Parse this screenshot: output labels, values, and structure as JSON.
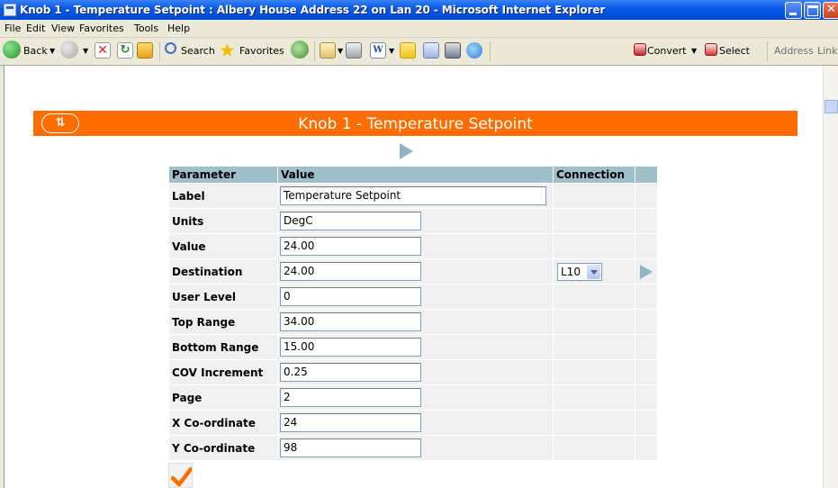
{
  "window": {
    "title": "Knob 1 - Temperature Setpoint : Albery House Address 22 on Lan 20 - Microsoft Internet Explorer"
  },
  "menu": [
    "File",
    "Edit",
    "View",
    "Favorites",
    "Tools",
    "Help"
  ],
  "toolbar": {
    "back": "Back",
    "search": "Search",
    "favorites": "Favorites",
    "convert": "Convert",
    "select": "Select",
    "address": "Address",
    "links": "Links"
  },
  "page": {
    "title": "Knob 1 - Temperature Setpoint",
    "columns": {
      "parameter": "Parameter",
      "value": "Value",
      "connection": "Connection"
    },
    "rows": [
      {
        "label": "Label",
        "value": "Temperature Setpoint"
      },
      {
        "label": "Units",
        "value": "DegC"
      },
      {
        "label": "Value",
        "value": "24.00"
      },
      {
        "label": "Destination",
        "value": "24.00",
        "connection": "L10"
      },
      {
        "label": "User Level",
        "value": "0"
      },
      {
        "label": "Top Range",
        "value": "34.00"
      },
      {
        "label": "Bottom Range",
        "value": "15.00"
      },
      {
        "label": "COV Increment",
        "value": "0.25"
      },
      {
        "label": "Page",
        "value": "2"
      },
      {
        "label": "X Co-ordinate",
        "value": "24"
      },
      {
        "label": "Y Co-ordinate",
        "value": "98"
      }
    ]
  },
  "colors": {
    "header": "#ff6c00",
    "table_header": "#9fc0ca",
    "cell": "#f0f0f0",
    "checkmark": "#ff6c00",
    "arrow": "#91b4c4"
  }
}
